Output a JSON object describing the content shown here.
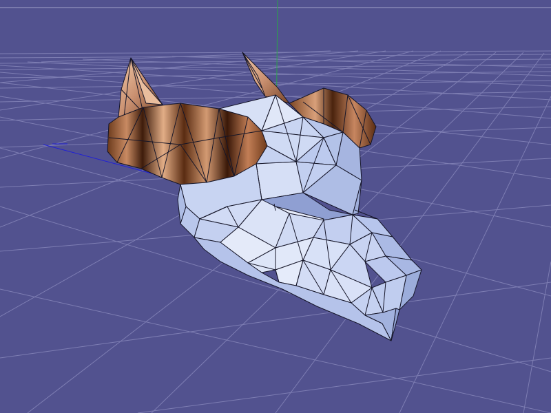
{
  "viewport": {
    "background_color": "#52528f",
    "grid_color": "#7e7eb3",
    "horizon_color": "#a3a3c8",
    "axis_colors": {
      "x": "#1f1fd6",
      "y": "#2aa34a"
    }
  },
  "model": {
    "name_icon": "wolf-head-lowpoly-mesh",
    "main_color": "#c2cff0",
    "edge_color": "#151528",
    "fur_texture_colors": [
      "#e8b896",
      "#c48a64",
      "#8a5634",
      "#4a2612",
      "#f2c9a8"
    ]
  }
}
